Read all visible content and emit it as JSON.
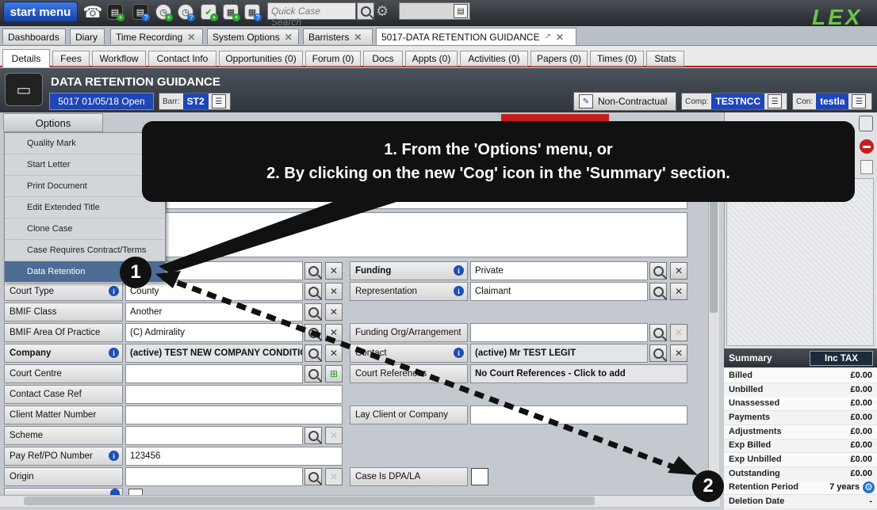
{
  "topbar": {
    "start_menu": "start menu",
    "quick_case_search_placeholder": "Quick Case Search",
    "logo": "LEX"
  },
  "tabs_top": [
    {
      "label": "Dashboards"
    },
    {
      "label": "Diary"
    },
    {
      "label": "Time Recording"
    },
    {
      "label": "System Options"
    },
    {
      "label": "Barristers"
    },
    {
      "label": "5017-DATA RETENTION GUIDANCE"
    }
  ],
  "tabs_case": [
    {
      "label": "Details"
    },
    {
      "label": "Fees"
    },
    {
      "label": "Workflow"
    },
    {
      "label": "Contact Info"
    },
    {
      "label": "Opportunities (0)"
    },
    {
      "label": "Forum (0)"
    },
    {
      "label": "Docs"
    },
    {
      "label": "Appts (0)"
    },
    {
      "label": "Activities (0)"
    },
    {
      "label": "Papers (0)"
    },
    {
      "label": "Times (0)"
    },
    {
      "label": "Stats"
    }
  ],
  "case": {
    "title": "DATA RETENTION GUIDANCE",
    "status": "5017 01/05/18 Open",
    "barr_label": "Barr:",
    "barr_value": "ST2",
    "non_contractual": "Non-Contractual",
    "comp_label": "Comp:",
    "comp_value": "TESTNCC",
    "con_label": "Con:",
    "con_value": "testla"
  },
  "options": {
    "label": "Options",
    "items": [
      "Quality Mark",
      "Start Letter",
      "Print Document",
      "Edit Extended Title",
      "Clone Case",
      "Case Requires Contract/Terms",
      "Data Retention"
    ]
  },
  "callout": {
    "line1": "1. From the 'Options' menu, or",
    "line2": "2. By clicking on the new 'Cog' icon in the 'Summary' section.",
    "marker1": "1",
    "marker2": "2"
  },
  "form": {
    "court_type_label": "Court Type",
    "court_type_value": "County",
    "bmif_class_label": "BMIF Class",
    "bmif_class_value": "Another",
    "bmif_area_label": "BMIF Area Of Practice",
    "bmif_area_value": "(C) Admirality",
    "company_label": "Company",
    "company_value": "(active) TEST NEW COMPANY CONDITIONS",
    "court_centre_label": "Court Centre",
    "contact_case_ref_label": "Contact Case Ref",
    "client_matter_label": "Client Matter Number",
    "scheme_label": "Scheme",
    "pay_ref_label": "Pay Ref/PO Number",
    "pay_ref_value": "123456",
    "origin_label": "Origin",
    "funding_label": "Funding",
    "funding_value": "Private",
    "representation_label": "Representation",
    "representation_value": "Claimant",
    "funding_org_label": "Funding Org/Arrangement",
    "contact_label": "Contact",
    "contact_value": "(active) Mr TEST LEGIT",
    "court_refs_label": "Court References",
    "court_refs_value": "No Court References - Click to add",
    "lay_client_label": "Lay Client or Company",
    "case_dpa_label": "Case Is DPA/LA"
  },
  "summary": {
    "title": "Summary",
    "tax_toggle": "Inc TAX",
    "rows": [
      {
        "label": "Billed",
        "value": "£0.00"
      },
      {
        "label": "Unbilled",
        "value": "£0.00"
      },
      {
        "label": "Unassessed",
        "value": "£0.00"
      },
      {
        "label": "Payments",
        "value": "£0.00"
      },
      {
        "label": "Adjustments",
        "value": "£0.00"
      },
      {
        "label": "Exp Billed",
        "value": "£0.00"
      },
      {
        "label": "Exp Unbilled",
        "value": "£0.00"
      },
      {
        "label": "Outstanding",
        "value": "£0.00"
      }
    ],
    "retention_label": "Retention Period",
    "retention_value": "7 years",
    "deletion_label": "Deletion Date",
    "deletion_value": "-"
  },
  "colors": {
    "accent": "#1f46b8",
    "header": "#2f353b",
    "callout": "#111111",
    "logo": "#6fc24a"
  }
}
